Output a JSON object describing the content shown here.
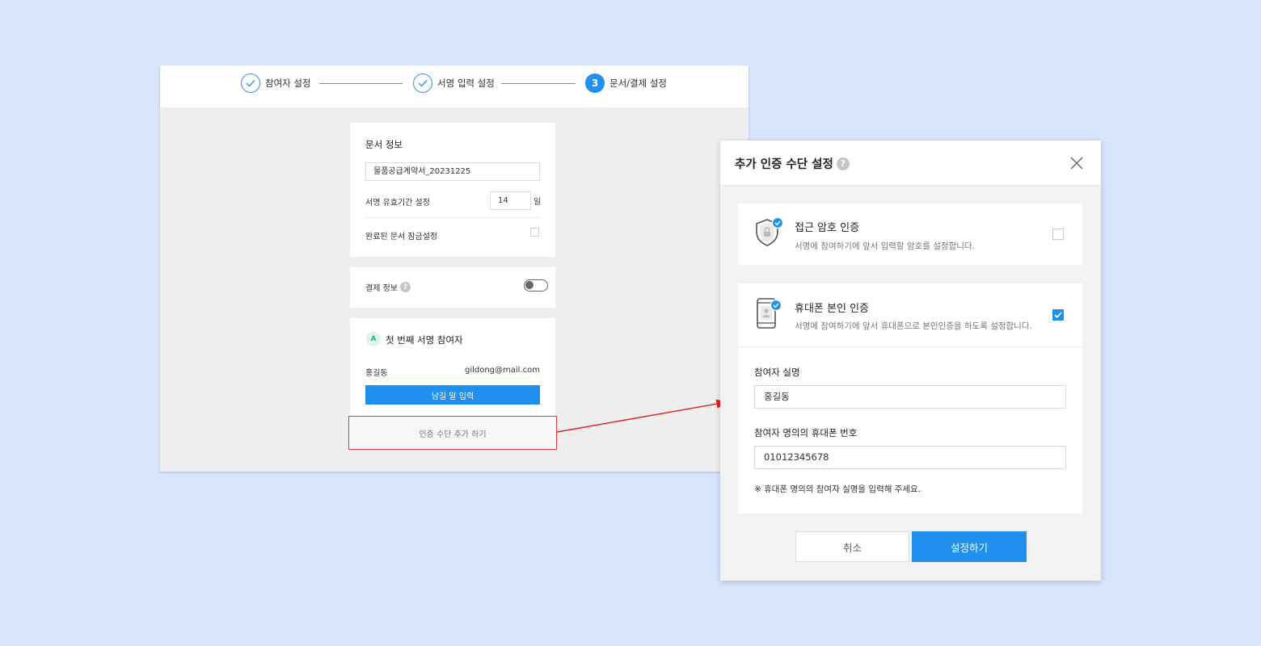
{
  "stepper": {
    "steps": [
      {
        "label": "참여자 설정",
        "status": "done"
      },
      {
        "label": "서명 입력 설정",
        "status": "done"
      },
      {
        "number": "3",
        "label": "문서/결제 설정",
        "status": "active"
      }
    ]
  },
  "doc_info": {
    "title": "문서 정보",
    "doc_name": "물품공급계약서_20231225",
    "validity_label": "서명 유효기간 설정",
    "validity_days": "14",
    "validity_unit": "일",
    "lock_label": "완료된 문서 잠금설정",
    "lock_checked": false
  },
  "payment": {
    "label": "결제 정보",
    "help": "?",
    "enabled": false
  },
  "participant": {
    "badge": "A",
    "title": "첫 번째 서명 참여자",
    "name": "홍길동",
    "email": "gildong@mail.com",
    "button_label": "남길 말 입력"
  },
  "add_auth_button": "인증 수단 추가 하기",
  "colors": {
    "accent": "#1f8ff0",
    "highlight_border": "#e23a3a",
    "background": "#d7e6fd"
  },
  "modal": {
    "title": "추가 인증 수단 설정",
    "help": "?",
    "options": [
      {
        "icon": "shield-lock-icon",
        "title": "접근 암호 인증",
        "description": "서명에 참여하기에 앞서 입력할 암호를 설정합니다.",
        "checked": false
      },
      {
        "icon": "phone-verify-icon",
        "title": "휴대폰 본인 인증",
        "description": "서명에 참여하기에 앞서 휴대폰으로 본인인증을 하도록 설정합니다.",
        "checked": true
      }
    ],
    "name_label": "참여자 실명",
    "name_value": "홍길동",
    "phone_label": "참여자 명의의 휴대폰 번호",
    "phone_value": "01012345678",
    "note": "※ 휴대폰 명의의 참여자 실명을 입력해 주세요.",
    "cancel_label": "취소",
    "confirm_label": "설정하기"
  }
}
